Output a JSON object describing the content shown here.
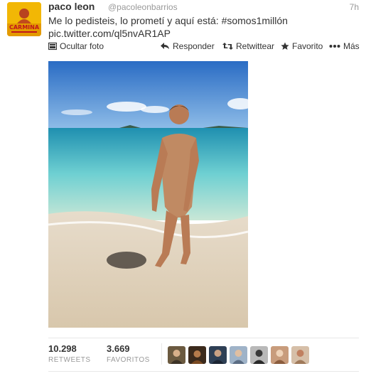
{
  "tweet": {
    "name": "paco leon",
    "handle": "@pacoleonbarrios",
    "time": "7h",
    "text": "Me lo pedisteis, lo prometí y aquí está: #somos1millón",
    "link": "pic.twitter.com/ql5nvAR1AP",
    "avatar_icon": "profile-photo",
    "avatar_text": "CARMINA"
  },
  "actions": {
    "hide_photo": "Ocultar foto",
    "reply": "Responder",
    "retweet": "Retwittear",
    "favorite": "Favorito",
    "more": "Más"
  },
  "stats": {
    "retweets_count": "10.298",
    "retweets_label": "RETWEETS",
    "favorites_count": "3.669",
    "favorites_label": "FAVORITOS"
  },
  "favoriters": [
    {
      "icon": "user-avatar",
      "color": "#6b5a40"
    },
    {
      "icon": "user-avatar",
      "color": "#3b2a1c"
    },
    {
      "icon": "user-avatar",
      "color": "#2e3f55"
    },
    {
      "icon": "user-avatar",
      "color": "#9fb3c8"
    },
    {
      "icon": "user-avatar",
      "color": "#b9b9b9"
    },
    {
      "icon": "user-avatar",
      "color": "#c89c7c"
    },
    {
      "icon": "user-avatar",
      "color": "#d6bfa8"
    }
  ],
  "colors": {
    "text": "#333333",
    "muted": "#999999",
    "divider": "#e8e8e8"
  }
}
